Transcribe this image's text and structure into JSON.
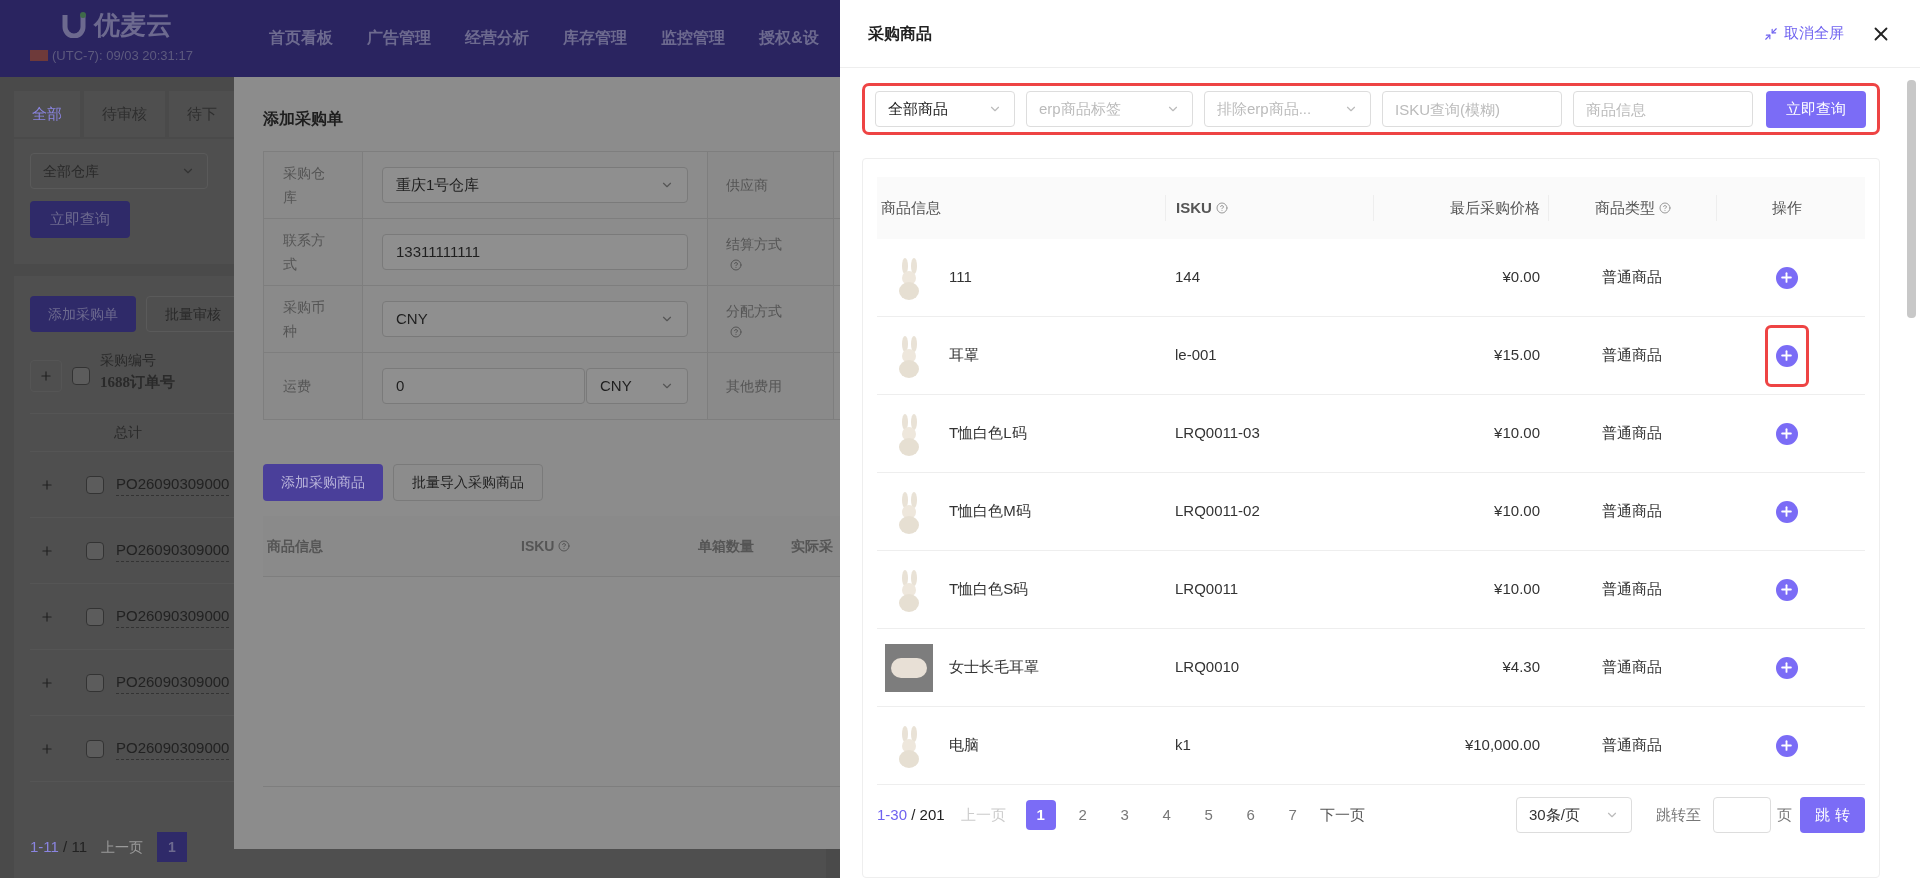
{
  "app": {
    "logo": "优麦云",
    "clock": "(UTC-7): 09/03 20:31:17",
    "nav": [
      "首页看板",
      "广告管理",
      "经营分析",
      "库存管理",
      "监控管理",
      "授权&设"
    ],
    "tabs": [
      {
        "label": "全部",
        "selected": true
      },
      {
        "label": "待审核",
        "selected": false
      },
      {
        "label": "待下",
        "selected": false
      }
    ],
    "warehouse_select": "全部仓库",
    "query_button": "立即查询",
    "actions": [
      {
        "label": "添加采购单",
        "primary": true
      },
      {
        "label": "批量审核",
        "primary": false
      }
    ],
    "table": {
      "column_1": "采购编号",
      "column_1_sub": "1688订单号",
      "total": "总计",
      "header_checked": false,
      "rows": [
        {
          "order": "PO26090309000",
          "checked": false
        },
        {
          "order": "PO26090309000",
          "checked": false
        },
        {
          "order": "PO26090309000",
          "checked": false
        },
        {
          "order": "PO26090309000",
          "checked": false
        },
        {
          "order": "PO26090309000",
          "checked": false
        }
      ]
    },
    "pagination": {
      "range": "1-11",
      "total": "/ 11",
      "prev": "上一页",
      "page": "1"
    }
  },
  "modal": {
    "title": "添加采购单",
    "form": [
      {
        "label": "采购仓库",
        "kind": "select",
        "value": "重庆1号仓库",
        "right_label": "供应商",
        "right_help": false
      },
      {
        "label": "联系方式",
        "kind": "input",
        "value": "13311111111",
        "right_label": "结算方式",
        "right_help": true
      },
      {
        "label": "采购币种",
        "kind": "select",
        "value": "CNY",
        "right_label": "分配方式",
        "right_help": true
      },
      {
        "label": "运费",
        "kind": "input_currency",
        "value": "0",
        "currency": "CNY",
        "right_label": "其他费用",
        "right_help": false
      }
    ],
    "buttons": [
      {
        "label": "添加采购商品",
        "primary": true
      },
      {
        "label": "批量导入采购商品",
        "primary": false
      }
    ],
    "columns": [
      {
        "label": "商品信息",
        "help": false
      },
      {
        "label": "ISKU",
        "help": true
      },
      {
        "label": "单箱数量",
        "help": false
      },
      {
        "label": "实际采",
        "help": false
      }
    ]
  },
  "drawer": {
    "title": "采购商品",
    "fullscreen": "取消全屏",
    "filters_highlighted": true,
    "filters": [
      {
        "kind": "select",
        "value": "全部商品"
      },
      {
        "kind": "select",
        "placeholder": "erp商品标签"
      },
      {
        "kind": "select",
        "placeholder": "排除erp商品..."
      },
      {
        "kind": "input",
        "placeholder": "ISKU查询(模糊)"
      },
      {
        "kind": "input",
        "placeholder": "商品信息"
      }
    ],
    "query_button": "立即查询",
    "columns": [
      {
        "label": "商品信息",
        "help": false
      },
      {
        "label": "ISKU",
        "help": true
      },
      {
        "label": "最后采购价格",
        "help": false
      },
      {
        "label": "商品类型",
        "help": true
      },
      {
        "label": "操作",
        "help": false
      }
    ],
    "rows": [
      {
        "kind": "toy",
        "name": "111",
        "isku": "144",
        "price": "¥0.00",
        "type": "普通商品",
        "highlighted": false
      },
      {
        "kind": "toy",
        "name": "耳罩",
        "isku": "le-001",
        "price": "¥15.00",
        "type": "普通商品",
        "highlighted": true
      },
      {
        "kind": "toy",
        "name": "T恤白色L码",
        "isku": "LRQ0011-03",
        "price": "¥10.00",
        "type": "普通商品",
        "highlighted": false
      },
      {
        "kind": "toy",
        "name": "T恤白色M码",
        "isku": "LRQ0011-02",
        "price": "¥10.00",
        "type": "普通商品",
        "highlighted": false
      },
      {
        "kind": "toy",
        "name": "T恤白色S码",
        "isku": "LRQ0011",
        "price": "¥10.00",
        "type": "普通商品",
        "highlighted": false
      },
      {
        "kind": "fur",
        "name": "女士长毛耳罩",
        "isku": "LRQ0010",
        "price": "¥4.30",
        "type": "普通商品",
        "highlighted": false
      },
      {
        "kind": "toy",
        "name": "电脑",
        "isku": "k1",
        "price": "¥10,000.00",
        "type": "普通商品",
        "highlighted": false
      }
    ],
    "pagination": {
      "range": "1-30",
      "total": "/ 201",
      "prev": "上一页",
      "prev_disabled": true,
      "pages": [
        {
          "label": "1",
          "selected": true
        },
        {
          "label": "2",
          "selected": false
        },
        {
          "label": "3",
          "selected": false
        },
        {
          "label": "4",
          "selected": false
        },
        {
          "label": "5",
          "selected": false
        },
        {
          "label": "6",
          "selected": false
        },
        {
          "label": "7",
          "selected": false
        }
      ],
      "next": "下一页",
      "page_size": "30条/页",
      "jump_label": "跳转至",
      "page_unit": "页",
      "jump_button": "跳 转"
    }
  }
}
